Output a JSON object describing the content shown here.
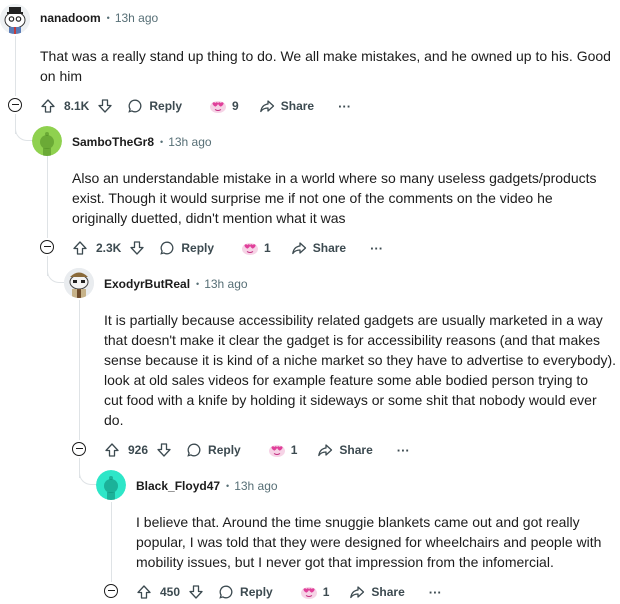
{
  "comments": [
    {
      "username": "nanadoom",
      "time": "13h ago",
      "lines": [
        "That was a really stand up thing to do. We all make mistakes, and he owned up to his. Good",
        "on him"
      ],
      "votes": "8.1K",
      "reply": "Reply",
      "awards": "9",
      "share": "Share",
      "more": "···"
    },
    {
      "username": "SamboTheGr8",
      "time": "13h ago",
      "lines": [
        "Also an understandable mistake in a world where so many useless gadgets/products",
        "exist. Though it would surprise me if not one of the comments on the video he",
        "originally duetted, didn't mention what it was"
      ],
      "votes": "2.3K",
      "reply": "Reply",
      "awards": "1",
      "share": "Share",
      "more": "···"
    },
    {
      "username": "ExodyrButReal",
      "time": "13h ago",
      "lines": [
        "It is partially because accessibility related gadgets are usually marketed in a way",
        "that doesn't make it clear the gadget is for accessibility reasons (and that makes",
        "sense because it is kind of a niche market so they have to advertise to everybody).",
        "look at old sales videos for example feature some able bodied person trying to",
        "cut food with a knife by holding it sideways or some shit that nobody would ever",
        "do."
      ],
      "votes": "926",
      "reply": "Reply",
      "awards": "1",
      "share": "Share",
      "more": "···"
    },
    {
      "username": "Black_Floyd47",
      "time": "13h ago",
      "lines": [
        "I believe that. Around the time snuggie blankets came out and got really",
        "popular, I was told that they were designed for wheelchairs and people with",
        "mobility issues, but I never got that impression from the infomercial."
      ],
      "votes": "450",
      "reply": "Reply",
      "awards": "1",
      "share": "Share",
      "more": "···"
    }
  ],
  "colors": {
    "avatar_green": "#8fd14f",
    "avatar_teal": "#2ee6c8",
    "award_pink": "#e0409a",
    "text_muted": "#576f76"
  }
}
